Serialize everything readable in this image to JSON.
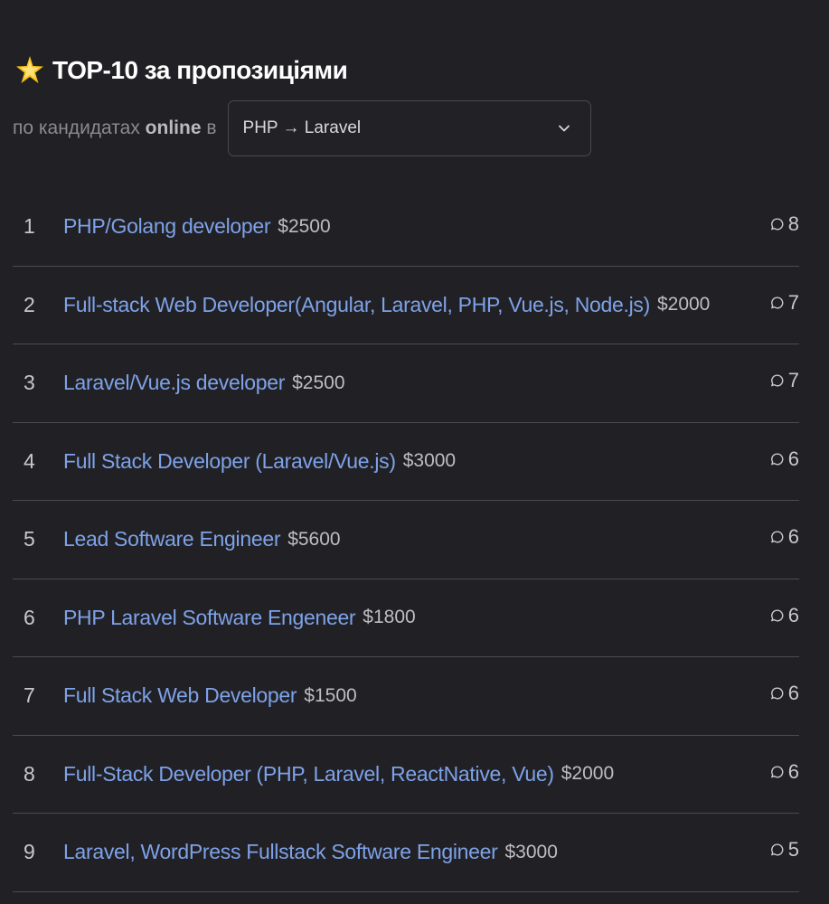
{
  "header": {
    "title": "TOP-10 за пропозиціями"
  },
  "filter": {
    "prefix": "по кандидатах",
    "bold": "online",
    "suffix": "в",
    "selected_option": "PHP → Laravel"
  },
  "colors": {
    "background": "#212125",
    "link": "#7ea2e8",
    "divider": "#4a4a50",
    "star": "#f7c21a"
  },
  "items": [
    {
      "rank": "1",
      "title": "PHP/Golang developer",
      "salary": "$2500",
      "count": "8"
    },
    {
      "rank": "2",
      "title": "Full-stack Web Developer(Angular, Laravel, PHP, Vue.js, Node.js)",
      "salary": "$2000",
      "count": "7"
    },
    {
      "rank": "3",
      "title": "Laravel/Vue.js developer",
      "salary": "$2500",
      "count": "7"
    },
    {
      "rank": "4",
      "title": "Full Stack Developer (Laravel/Vue.js)",
      "salary": "$3000",
      "count": "6"
    },
    {
      "rank": "5",
      "title": "Lead Software Engineer",
      "salary": "$5600",
      "count": "6"
    },
    {
      "rank": "6",
      "title": "PHP Laravel Software Engeneer",
      "salary": "$1800",
      "count": "6"
    },
    {
      "rank": "7",
      "title": "Full Stack Web Developer",
      "salary": "$1500",
      "count": "6"
    },
    {
      "rank": "8",
      "title": "Full-Stack Developer (PHP, Laravel, ReactNative, Vue)",
      "salary": "$2000",
      "count": "6"
    },
    {
      "rank": "9",
      "title": "Laravel, WordPress Fullstack Software Engineer",
      "salary": "$3000",
      "count": "5"
    }
  ]
}
